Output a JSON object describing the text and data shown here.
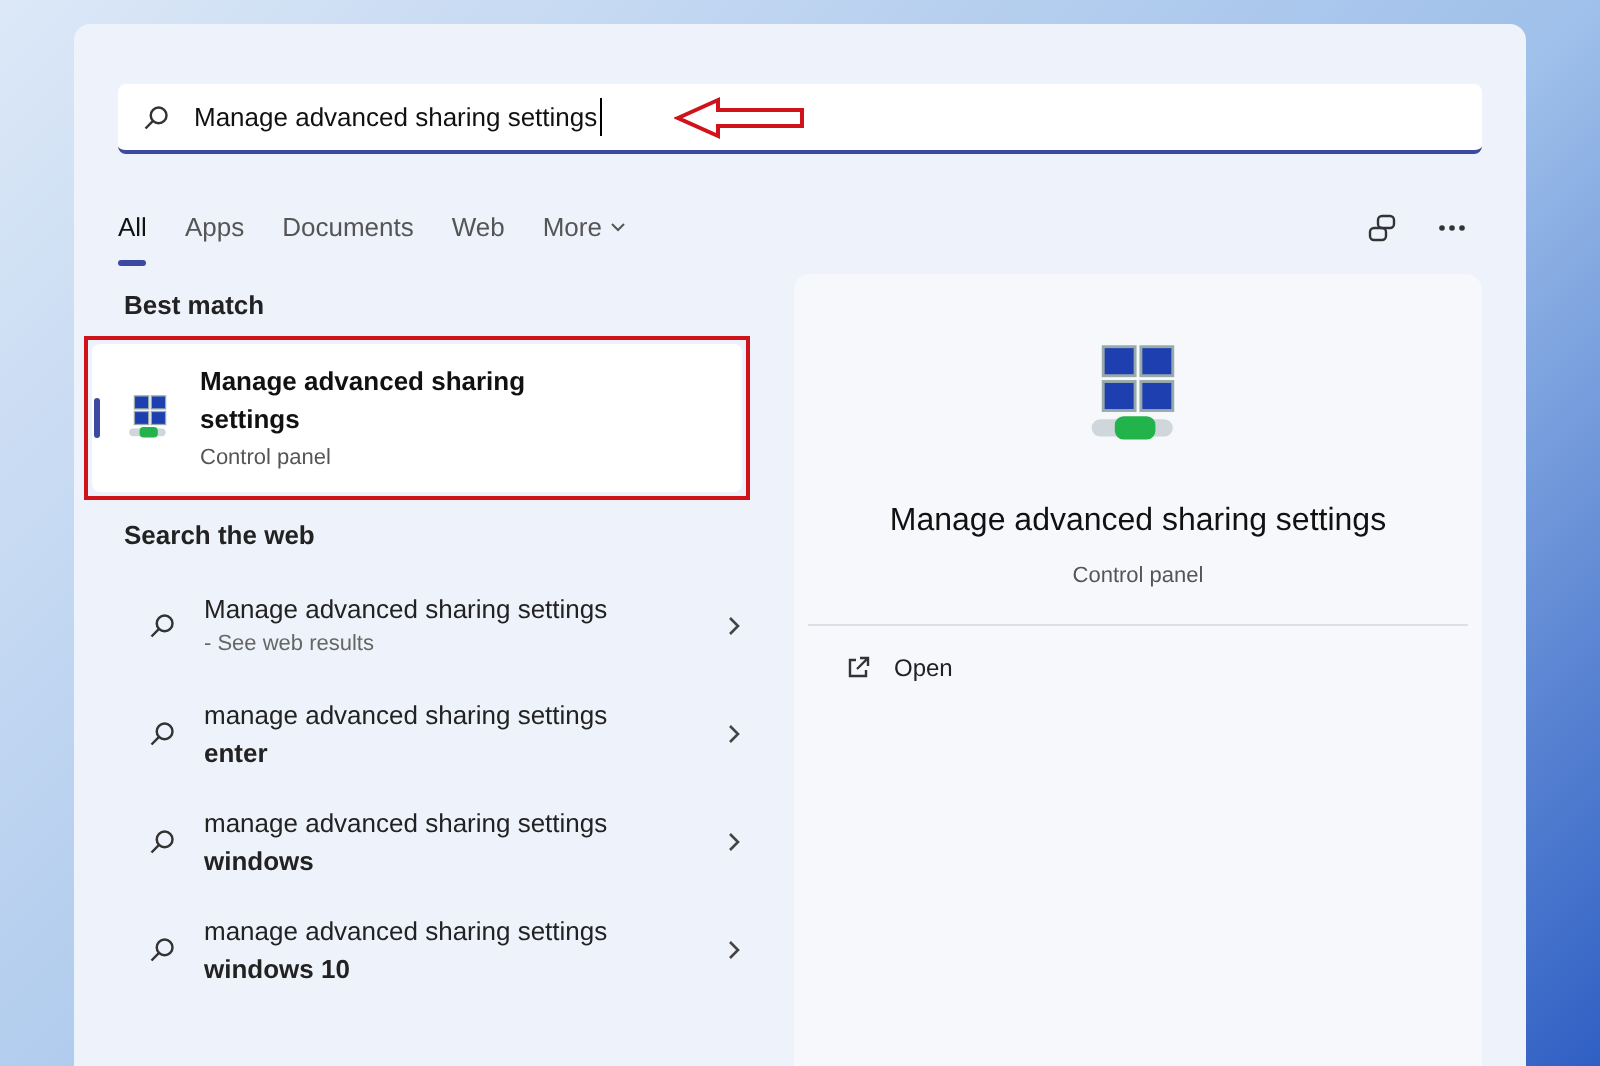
{
  "search": {
    "value": "Manage advanced sharing settings"
  },
  "tabs": [
    {
      "label": "All",
      "selected": true
    },
    {
      "label": "Apps",
      "selected": false
    },
    {
      "label": "Documents",
      "selected": false
    },
    {
      "label": "Web",
      "selected": false
    },
    {
      "label": "More",
      "selected": false
    }
  ],
  "best_match": {
    "heading": "Best match",
    "title": "Manage advanced sharing settings",
    "subtitle": "Control panel",
    "selected": true
  },
  "web": {
    "heading": "Search the web",
    "items": [
      {
        "kind": "see_results",
        "text": "Manage advanced sharing settings",
        "detail": "- See web results"
      },
      {
        "kind": "suggestion",
        "text": "manage advanced sharing settings",
        "detail": "enter"
      },
      {
        "kind": "suggestion",
        "text": "manage advanced sharing settings",
        "detail": "windows"
      },
      {
        "kind": "suggestion",
        "text": "manage advanced sharing settings",
        "detail": "windows 10"
      }
    ]
  },
  "preview": {
    "title": "Manage advanced sharing settings",
    "subtitle": "Control panel",
    "actions": [
      "Open"
    ]
  }
}
